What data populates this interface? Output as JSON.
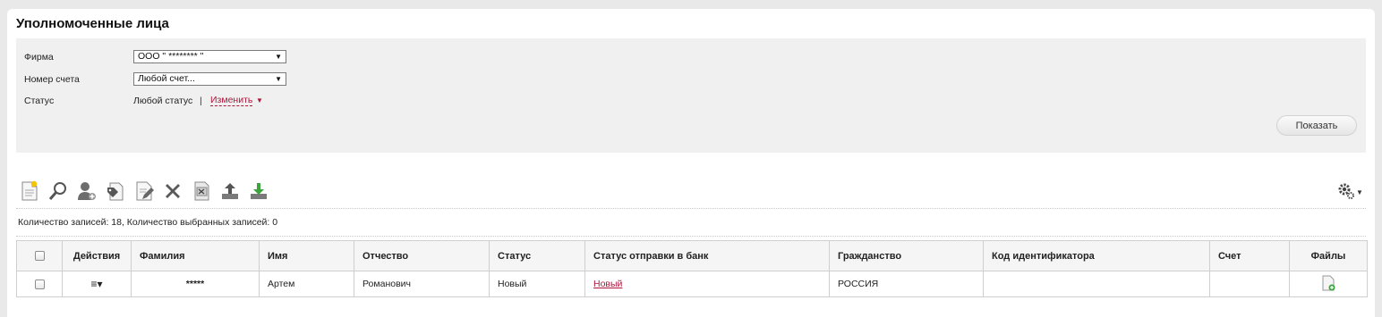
{
  "page": {
    "title": "Уполномоченные лица"
  },
  "filters": {
    "firm": {
      "label": "Фирма",
      "value": "ООО \"  ********  \""
    },
    "account": {
      "label": "Номер счета",
      "value": "Любой счет..."
    },
    "status": {
      "label": "Статус",
      "value": "Любой статус",
      "separator": "|",
      "change_link": "Изменить"
    },
    "show_button": "Показать"
  },
  "toolbar": {
    "icons": [
      "new-document-icon",
      "search-icon",
      "add-person-icon",
      "tag-document-icon",
      "edit-document-icon",
      "delete-icon",
      "excel-export-icon",
      "upload-icon",
      "download-icon"
    ],
    "settings_icon": "settings-gear-icon"
  },
  "records_info": "Количество записей: 18, Количество выбранных записей: 0",
  "table": {
    "columns": [
      "",
      "Действия",
      "Фамилия",
      "Имя",
      "Отчество",
      "Статус",
      "Статус отправки в банк",
      "Гражданство",
      "Код идентификатора",
      "Счет",
      "Файлы"
    ],
    "rows": [
      {
        "actions_icon": "≡▾",
        "surname": "*****",
        "name": "Артем",
        "patronymic": "Романович",
        "status": "Новый",
        "bank_status": "Новый",
        "citizenship": "РОССИЯ",
        "id_code": "",
        "account": "",
        "files_icon": "add-file-icon"
      }
    ]
  },
  "colors": {
    "link": "#b0163c",
    "filter_bg": "#f0f0f0",
    "page_bg": "#e9e9e9"
  }
}
